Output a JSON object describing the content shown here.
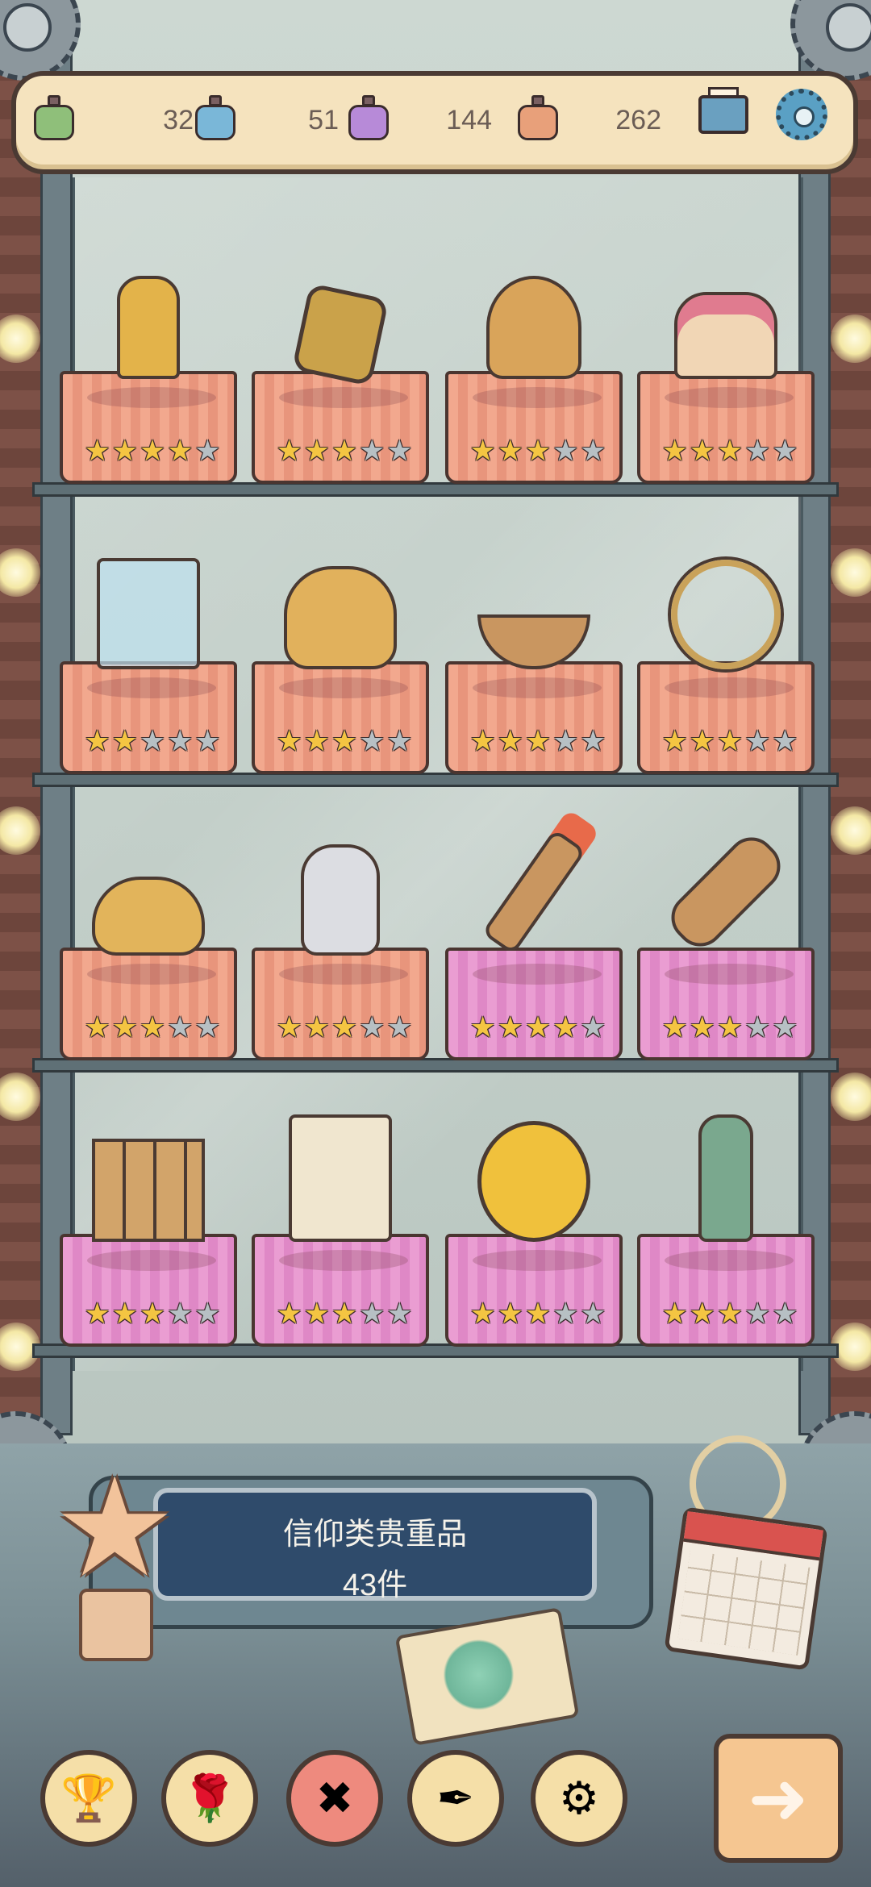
{
  "hud": {
    "resources": [
      {
        "icon": "green-potion-icon",
        "value": "32",
        "color": "#8fbf7a"
      },
      {
        "icon": "blue-potion-icon",
        "value": "51",
        "color": "#7ab7d8"
      },
      {
        "icon": "purple-potion-icon",
        "value": "144",
        "color": "#b78ad8"
      },
      {
        "icon": "orange-potion-icon",
        "value": "262",
        "color": "#e8a07a"
      }
    ],
    "mail_icon": "mail-icon",
    "settings_icon": "gear-icon"
  },
  "shelves": [
    {
      "items": [
        {
          "name": "golden-hand-statue",
          "stars": 4,
          "max": 5,
          "cloth": "orange"
        },
        {
          "name": "chained-lantern",
          "stars": 3,
          "max": 5,
          "cloth": "orange"
        },
        {
          "name": "three-faced-bust",
          "stars": 3,
          "max": 5,
          "cloth": "orange"
        },
        {
          "name": "cake-relic",
          "stars": 3,
          "max": 5,
          "cloth": "orange"
        }
      ]
    },
    {
      "items": [
        {
          "name": "scroll-in-glass-case",
          "stars": 2,
          "max": 5,
          "cloth": "orange"
        },
        {
          "name": "bread-basket",
          "stars": 3,
          "max": 5,
          "cloth": "orange"
        },
        {
          "name": "wooden-boat",
          "stars": 3,
          "max": 5,
          "cloth": "orange"
        },
        {
          "name": "armillary-sphere",
          "stars": 3,
          "max": 5,
          "cloth": "orange"
        }
      ]
    },
    {
      "items": [
        {
          "name": "mechanical-scarab",
          "stars": 3,
          "max": 5,
          "cloth": "orange"
        },
        {
          "name": "bearded-sage-figure",
          "stars": 3,
          "max": 5,
          "cloth": "orange"
        },
        {
          "name": "flaming-scepter",
          "stars": 4,
          "max": 5,
          "cloth": "pink"
        },
        {
          "name": "mummy-sarcophagus",
          "stars": 3,
          "max": 5,
          "cloth": "pink"
        }
      ]
    },
    {
      "items": [
        {
          "name": "wooden-tablets",
          "stars": 3,
          "max": 5,
          "cloth": "pink"
        },
        {
          "name": "sacred-scroll",
          "stars": 3,
          "max": 5,
          "cloth": "pink"
        },
        {
          "name": "golden-coin",
          "stars": 3,
          "max": 5,
          "cloth": "pink"
        },
        {
          "name": "zombie-hand",
          "stars": 3,
          "max": 5,
          "cloth": "pink"
        }
      ]
    }
  ],
  "panel": {
    "title": "信仰类贵重品",
    "count": "43件"
  },
  "nav": [
    {
      "icon": "trophy-icon",
      "glyph": "🏆"
    },
    {
      "icon": "rose-icon",
      "glyph": "🌹"
    },
    {
      "icon": "cross-icon",
      "glyph": "✖"
    },
    {
      "icon": "quill-scroll-icon",
      "glyph": "✒"
    },
    {
      "icon": "gear-icon",
      "glyph": "⚙"
    }
  ],
  "next_icon": "arrow-right-icon",
  "next_glyph": "➜"
}
